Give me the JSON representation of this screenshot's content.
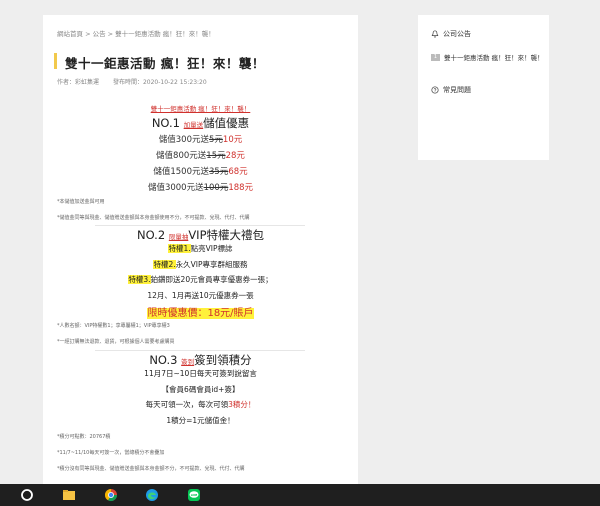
{
  "breadcrumb": "網站首頁 > 公告 > 雙十一鉅惠活動 瘋！狂！來！襲！",
  "article": {
    "title": "雙十一鉅惠活動 瘋！狂！來！襲！",
    "author": "作者：彩虹集運",
    "publish_time": "發布時間：2020-10-22 15:23:20",
    "headline": "雙十一鉅惠活動 瘋！狂！來！襲！",
    "s1": {
      "num": "NO.1 ",
      "tag": "加量送",
      "title": "儲值優惠",
      "rows": [
        {
          "pre": "儲值300元送",
          "old": "5元",
          "new": "10元"
        },
        {
          "pre": "儲值800元送",
          "old": "15元",
          "new": "28元"
        },
        {
          "pre": "儲值1500元送",
          "old": "35元",
          "new": "68元"
        },
        {
          "pre": "儲值3000元送",
          "old": "100元",
          "new": "188元"
        }
      ],
      "note1": "*本儲值加送金與可用",
      "note2": "*儲值金同等與現金、儲值贈送金額與本身金額使用不分，不可提款、兌現、代付、代購"
    },
    "s2": {
      "num": "NO.2 ",
      "tag": "限量抽",
      "title": "VIP特權大禮包",
      "p1_tag": "特權1.",
      "p1": "點亮VIP標誌",
      "p2_tag": "特權2.",
      "p2": "永久VIP專享群組服務",
      "p3_tag": "特權3.",
      "p3": "鉑鑽即送20元會員專享優惠券一張；",
      "p4": "12月、1月再送10元優惠券一張",
      "price": "限時優惠價：18元/賬戶",
      "note1": "*人數名額：VIP特權數1；享專屬權1；VIP專享權3",
      "note2": "*一經訂購無法退款、退貨，可根據個人需要考慮購買"
    },
    "s3": {
      "num": "NO.3 ",
      "tag": "簽到",
      "title": "簽到領積分",
      "line1": "11月7日~10日每天可簽到說留言",
      "line2": "【會員6碼會員id+簽】",
      "line3_pre": "每天可領一次，每次可領",
      "line3_red": "3積分！",
      "line4": "1積分=1元儲值金！",
      "note1": "*積分可點數：20767積",
      "note2": "*11/7~11/10每天可簽一次，當總積分不會疊加",
      "note3": "*積分沒有同等與現金、儲值贈送金額與本身金額不分，不可提款、兌現、代付、代購"
    }
  },
  "sidebar": {
    "announcements_title": "公司公告",
    "badge": "1",
    "announcement_item": "雙十一鉅惠活動 瘋！狂！來！襲！",
    "faq_title": "常見問題"
  },
  "taskbar": {
    "icons": [
      "start-circle",
      "file-explorer",
      "chrome",
      "edge",
      "line"
    ]
  }
}
